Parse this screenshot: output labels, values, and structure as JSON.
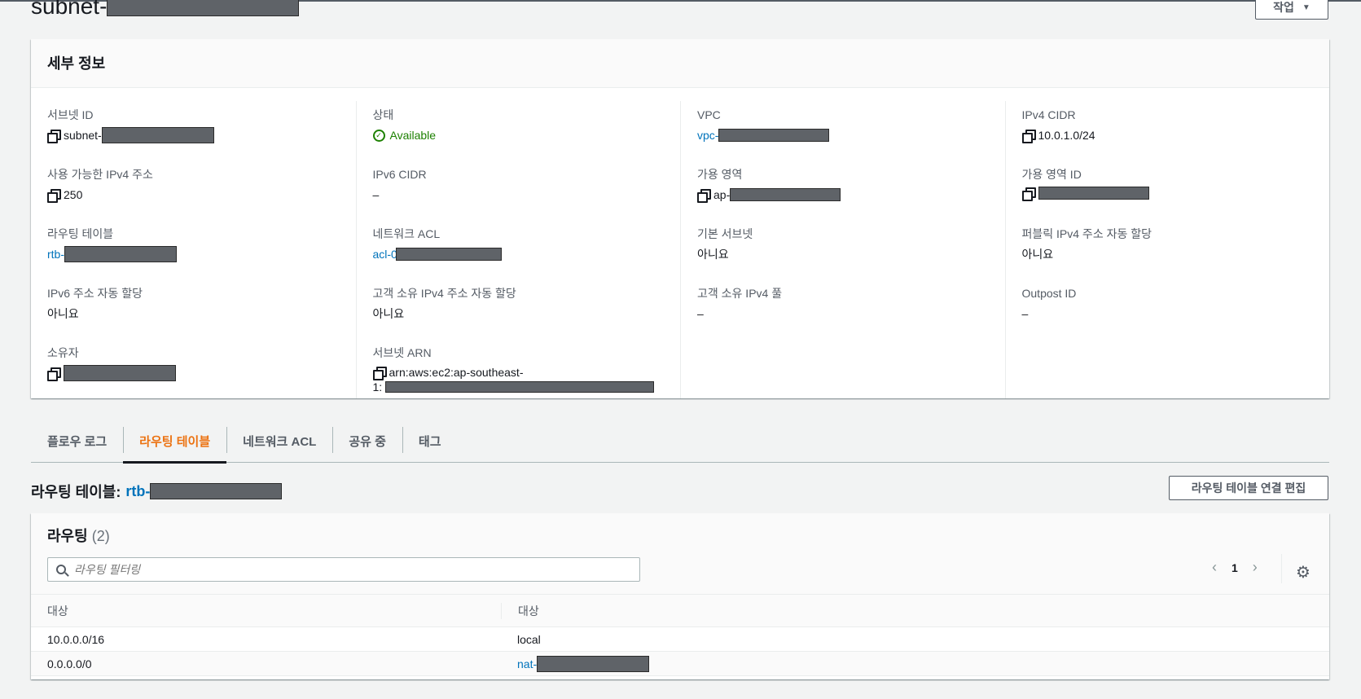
{
  "page": {
    "title_prefix": "subnet-"
  },
  "actions_label": "작업",
  "details": {
    "header": "세부 정보",
    "col1": [
      {
        "label": "서브넷 ID",
        "value": "subnet-"
      },
      {
        "label": "사용 가능한 IPv4 주소",
        "value": "250"
      },
      {
        "label": "라우팅 테이블",
        "value": "rtb-"
      },
      {
        "label": "IPv6 주소 자동 할당",
        "value": "아니요"
      },
      {
        "label": "소유자",
        "value": ""
      }
    ],
    "col2": [
      {
        "label": "상태",
        "value": "Available"
      },
      {
        "label": "IPv6 CIDR",
        "value": "–"
      },
      {
        "label": "네트워크 ACL",
        "value": "acl-0"
      },
      {
        "label": "고객 소유 IPv4 주소 자동 할당",
        "value": "아니요"
      },
      {
        "label": "서브넷 ARN",
        "value": "arn:aws:ec2:ap-southeast-",
        "value2": "1:"
      }
    ],
    "col3": [
      {
        "label": "VPC",
        "value": "vpc-"
      },
      {
        "label": "가용 영역",
        "value": "ap-"
      },
      {
        "label": "기본 서브넷",
        "value": "아니요"
      },
      {
        "label": "고객 소유 IPv4 풀",
        "value": "–"
      }
    ],
    "col4": [
      {
        "label": "IPv4 CIDR",
        "value": "10.0.1.0/24"
      },
      {
        "label": "가용 영역 ID",
        "value": ""
      },
      {
        "label": "퍼블릭 IPv4 주소 자동 할당",
        "value": "아니요"
      },
      {
        "label": "Outpost ID",
        "value": "–"
      }
    ]
  },
  "tabs": [
    "플로우 로그",
    "라우팅 테이블",
    "네트워크 ACL",
    "공유 중",
    "태그"
  ],
  "route_table": {
    "heading": "라우팅 테이블:",
    "id_prefix": "rtb-",
    "edit_button": "라우팅 테이블 연결 편집",
    "routes_title": "라우팅",
    "routes_count": "(2)",
    "filter_placeholder": "라우팅 필터링",
    "page": "1",
    "columns": [
      "대상",
      "대상"
    ],
    "rows": [
      {
        "dest": "10.0.0.0/16",
        "target": "local"
      },
      {
        "dest": "0.0.0.0/0",
        "target": "nat-"
      }
    ]
  },
  "colors": {
    "accent": "#ec7211",
    "link": "#0073bb",
    "ok": "#1d8102"
  }
}
